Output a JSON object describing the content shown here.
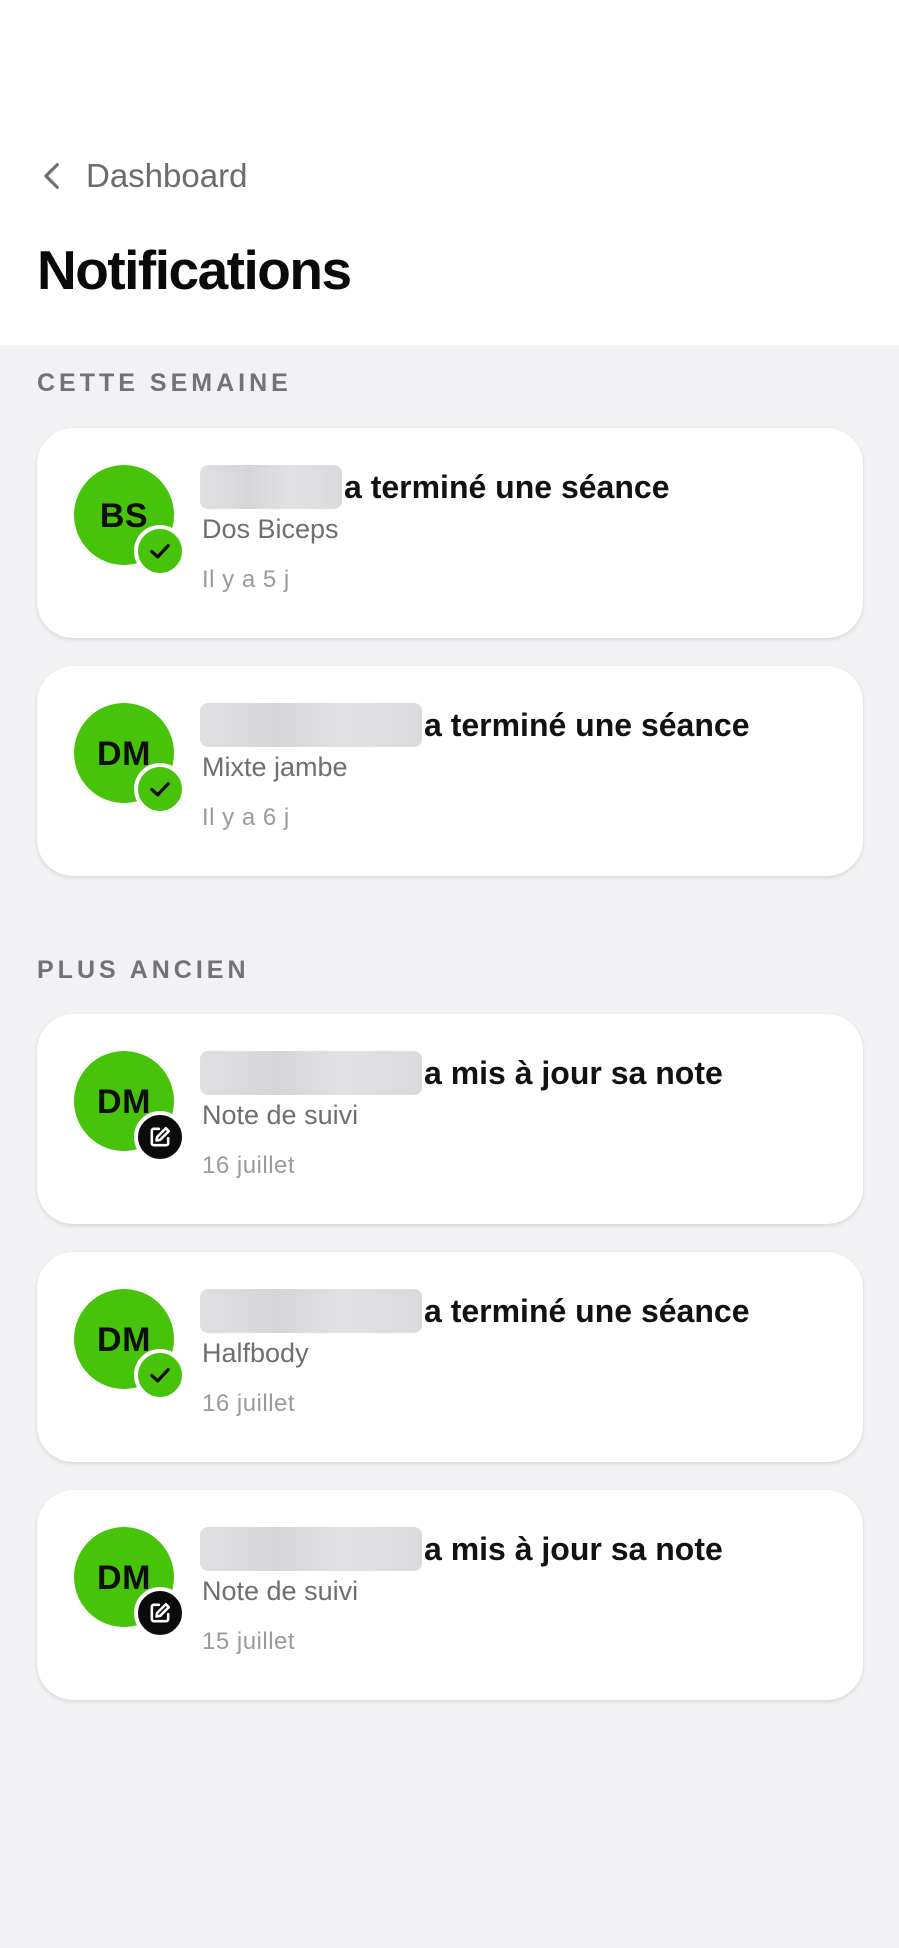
{
  "nav": {
    "back_label": "Dashboard"
  },
  "page": {
    "title": "Notifications"
  },
  "sections": [
    {
      "title": "CETTE SEMAINE",
      "items": [
        {
          "initials": "BS",
          "name": "",
          "action": "a terminé une séance",
          "subtitle": "Dos Biceps",
          "time": "Il y a 5 j",
          "badge": "check-icon"
        },
        {
          "initials": "DM",
          "name": "",
          "action": "a terminé une séance",
          "subtitle": "Mixte jambe",
          "time": "Il y a 6 j",
          "badge": "check-icon"
        }
      ]
    },
    {
      "title": "PLUS ANCIEN",
      "items": [
        {
          "initials": "DM",
          "name": "",
          "action": "a mis à jour sa note",
          "subtitle": "Note de suivi",
          "time": "16 juillet",
          "badge": "edit-icon"
        },
        {
          "initials": "DM",
          "name": "",
          "action": "a terminé une séance",
          "subtitle": "Halfbody",
          "time": "16 juillet",
          "badge": "check-icon"
        },
        {
          "initials": "DM",
          "name": "",
          "action": "a mis à jour sa note",
          "subtitle": "Note de suivi",
          "time": "15 juillet",
          "badge": "edit-icon"
        }
      ]
    }
  ],
  "colors": {
    "accent": "#47c40a",
    "background": "#f2f2f4",
    "card": "#ffffff",
    "badge_dark": "#0b0b0b"
  }
}
